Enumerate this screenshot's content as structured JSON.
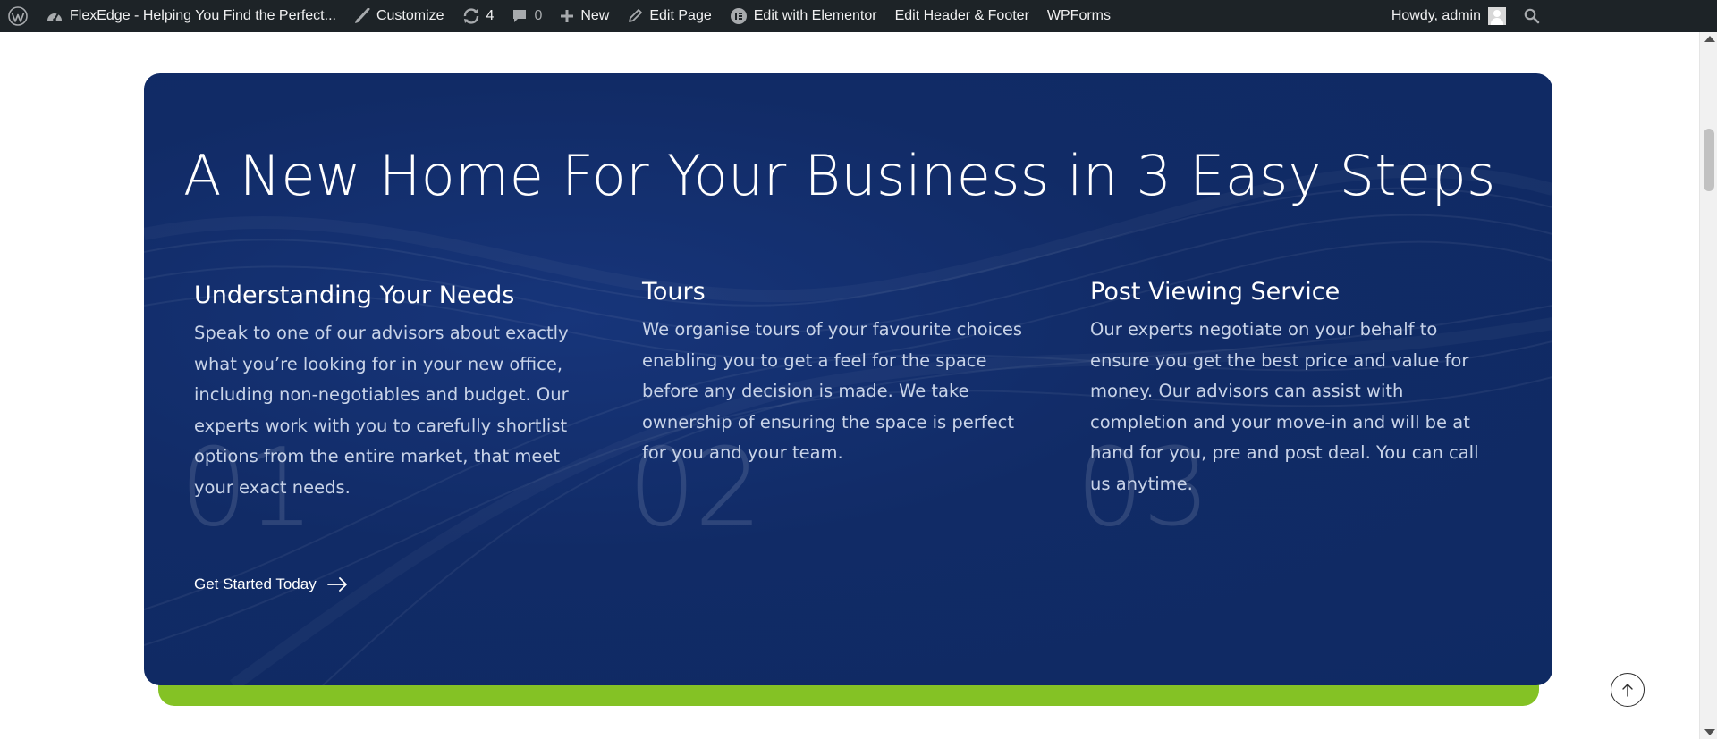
{
  "adminbar": {
    "site_name": "FlexEdge - Helping You Find the Perfect...",
    "customize": "Customize",
    "updates_count": "4",
    "comments_count": "0",
    "new": "New",
    "edit_page": "Edit Page",
    "edit_elementor": "Edit with Elementor",
    "edit_header_footer": "Edit Header & Footer",
    "wpforms": "WPForms",
    "howdy": "Howdy, admin"
  },
  "hero": {
    "headline": "A New Home For Your Business in 3 Easy Steps",
    "steps": [
      {
        "number": "01",
        "title": "Understanding Your Needs",
        "text": "Speak to one of our advisors about exactly what you’re looking for in your new office, including non-negotiables and budget. Our experts work with you to carefully shortlist options from the entire market, that meet your exact needs."
      },
      {
        "number": "02",
        "title": "Tours",
        "text": "We organise tours of your favourite choices enabling you to get a feel for the space before any decision is made. We take ownership of ensuring the space is perfect for you and your team."
      },
      {
        "number": "03",
        "title": "Post Viewing Service",
        "text": "Our experts negotiate on your behalf to ensure you get the best price and value for money. Our advisors can assist with completion and your move-in and will be at hand for you, pre and post deal. You can call us anytime."
      }
    ],
    "cta": "Get Started Today"
  },
  "colors": {
    "adminbar_bg": "#1d2327",
    "card_bg": "#112b66",
    "accent_green": "#84c225"
  },
  "icons": [
    "wordpress-icon",
    "dashboard-icon",
    "brush-icon",
    "updates-icon",
    "comment-icon",
    "plus-icon",
    "pencil-icon",
    "elementor-icon",
    "avatar",
    "search-icon",
    "arrow-right-icon",
    "arrow-up-icon"
  ]
}
